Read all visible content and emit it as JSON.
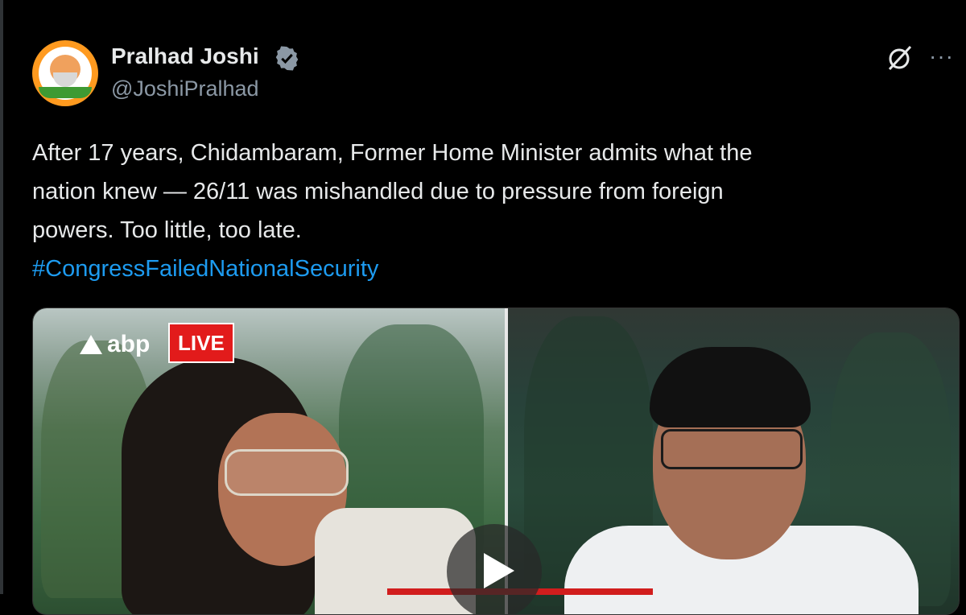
{
  "tweet": {
    "author": {
      "name": "Pralhad Joshi",
      "handle": "@JoshiPralhad",
      "verified": true
    },
    "text_lines": [
      "After 17 years, Chidambaram, Former Home Minister admits what the",
      "nation knew — 26/11 was mishandled due to pressure from foreign",
      "powers. Too little, too late."
    ],
    "hashtag": "#CongressFailedNationalSecurity",
    "media": {
      "channel_logo": "abp",
      "live_badge": "LIVE"
    },
    "icons": [
      "grok-icon",
      "more-options-icon",
      "verified-badge-icon",
      "play-icon"
    ]
  },
  "colors": {
    "background": "#000000",
    "text": "#e7e9ea",
    "muted": "#8b98a5",
    "link": "#1d9bf0",
    "live_red": "#e21b1b"
  }
}
